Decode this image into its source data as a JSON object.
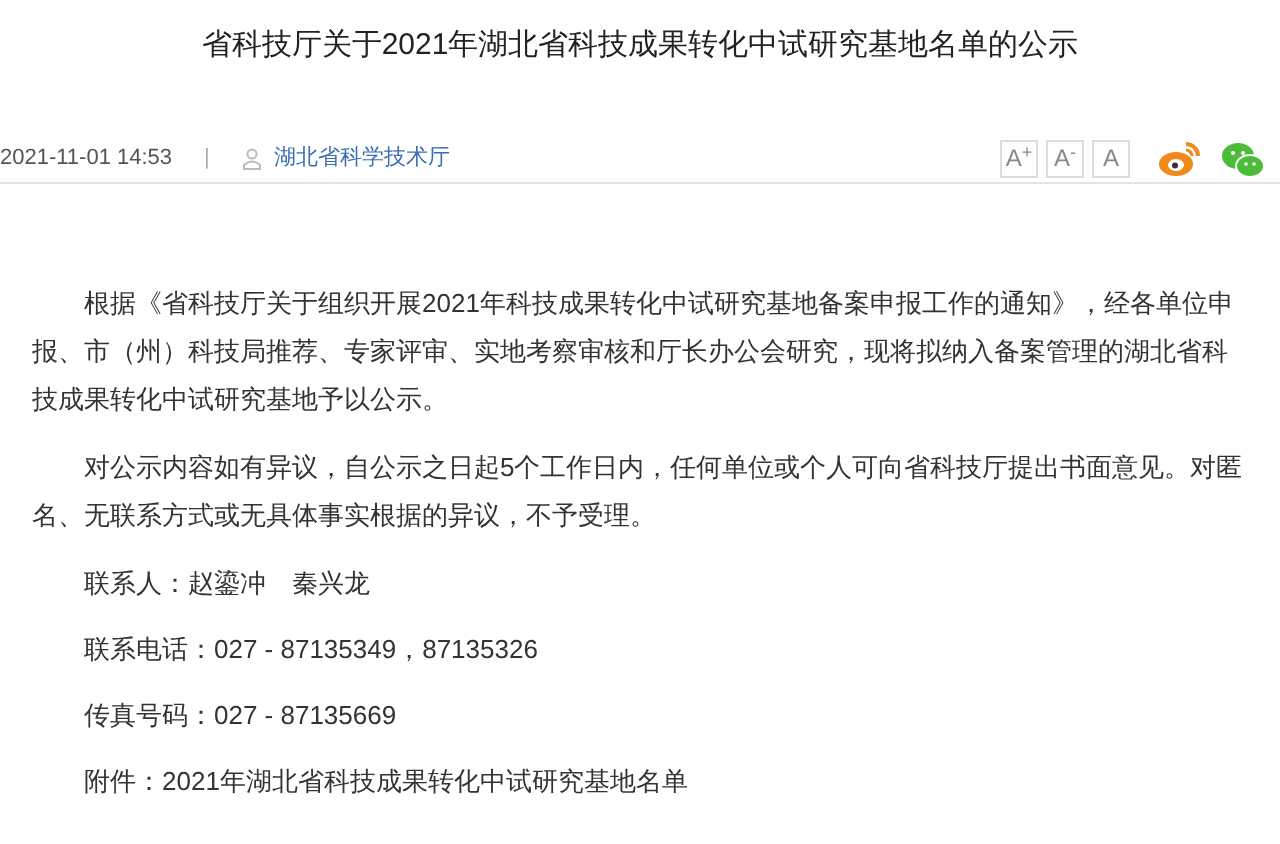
{
  "title": "省科技厅关于2021年湖北省科技成果转化中试研究基地名单的公示",
  "meta": {
    "date": "2021-11-01 14:53",
    "separator": "|",
    "source": "湖北省科学技术厅"
  },
  "font_buttons": [
    "A$^{+}$",
    "A$^{-}$",
    "A"
  ],
  "paragraphs": [
    {
      "kind": "indent",
      "text": "根据《省科技厅关于组织开展2021年科技成果转化中试研究基地备案申报工作的通知》，经各单位申报、市（州）科技局推荐、专家评审、实地考察审核和厅长办公会研究，现将拟纳入备案管理的湖北省科技成果转化中试研究基地予以公示。"
    },
    {
      "kind": "indent",
      "text": "对公示内容如有异议，自公示之日起5个工作日内，任何单位或个人可向省科技厅提出书面意见。对匿名、无联系方式或无具体事实根据的异议，不予受理。"
    },
    {
      "kind": "line",
      "text": "联系人：赵鎏冲　秦兴龙"
    },
    {
      "kind": "line",
      "text": "联系电话：027 - 87135349，87135326"
    },
    {
      "kind": "line",
      "text": "传真号码：027 - 87135669"
    },
    {
      "kind": "line",
      "text": "附件：2021年湖北省科技成果转化中试研究基地名单"
    }
  ]
}
